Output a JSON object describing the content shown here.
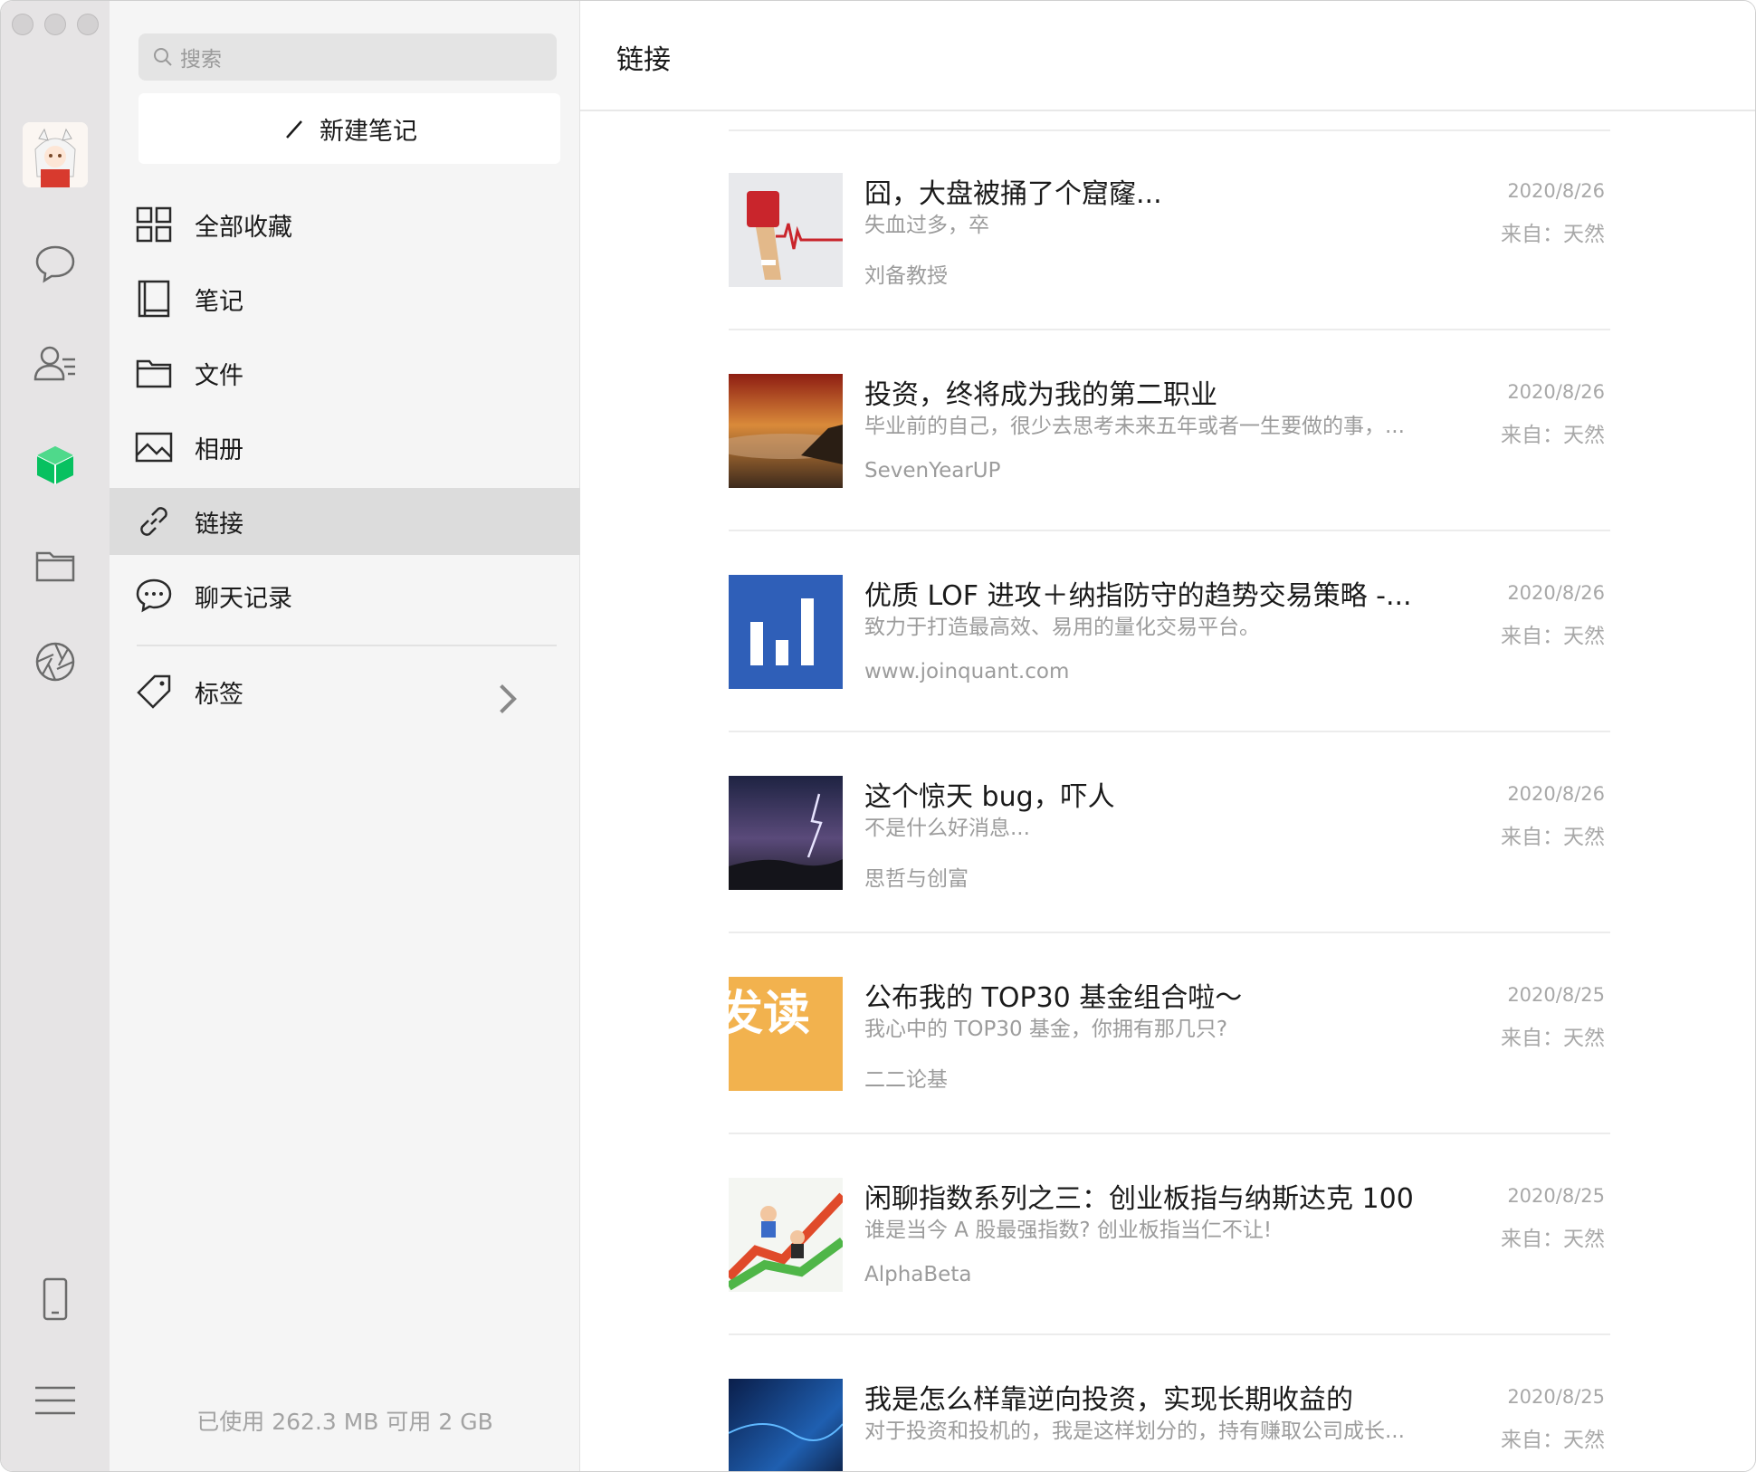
{
  "search": {
    "placeholder": "搜索"
  },
  "new_note_label": "新建笔记",
  "nav": [
    {
      "label": "全部收藏",
      "icon": "grid-icon"
    },
    {
      "label": "笔记",
      "icon": "notebook-icon"
    },
    {
      "label": "文件",
      "icon": "folder-icon"
    },
    {
      "label": "相册",
      "icon": "image-icon"
    },
    {
      "label": "链接",
      "icon": "link-icon",
      "active": true
    },
    {
      "label": "聊天记录",
      "icon": "chat-bubble-icon"
    }
  ],
  "tags_label": "标签",
  "storage": "已使用 262.3 MB 可用 2 GB",
  "main": {
    "title": "链接"
  },
  "items": [
    {
      "title": "囧，大盘被捅了个窟窿...",
      "desc": "失血过多，卒",
      "source": "刘备教授",
      "date": "2020/8/26",
      "from": "来自：天然"
    },
    {
      "title": "投资，终将成为我的第二职业",
      "desc": "毕业前的自己，很少去思考未来五年或者一生要做的事，...",
      "source": "SevenYearUP",
      "date": "2020/8/26",
      "from": "来自：天然"
    },
    {
      "title": "优质 LOF 进攻＋纳指防守的趋势交易策略 -...",
      "desc": "致力于打造最高效、易用的量化交易平台。",
      "source": "www.joinquant.com",
      "date": "2020/8/26",
      "from": "来自：天然"
    },
    {
      "title": "这个惊天 bug，吓人",
      "desc": "不是什么好消息...",
      "source": "思哲与创富",
      "date": "2020/8/26",
      "from": "来自：天然"
    },
    {
      "title": "公布我的 TOP30 基金组合啦～",
      "desc": "我心中的 TOP30 基金，你拥有那几只?",
      "source": "二二论基",
      "date": "2020/8/25",
      "from": "来自：天然"
    },
    {
      "title": "闲聊指数系列之三：创业板指与纳斯达克 100",
      "desc": "谁是当今 A 股最强指数? 创业板指当仁不让!",
      "source": "AlphaBeta",
      "date": "2020/8/25",
      "from": "来自：天然"
    },
    {
      "title": "我是怎么样靠逆向投资，实现长期收益的",
      "desc": "对于投资和投机的，我是这样划分的，持有赚取公司成长...",
      "source": "",
      "date": "2020/8/25",
      "from": "来自：天然"
    }
  ],
  "thumb_text_5": "发读",
  "accent_color": "#07c160"
}
